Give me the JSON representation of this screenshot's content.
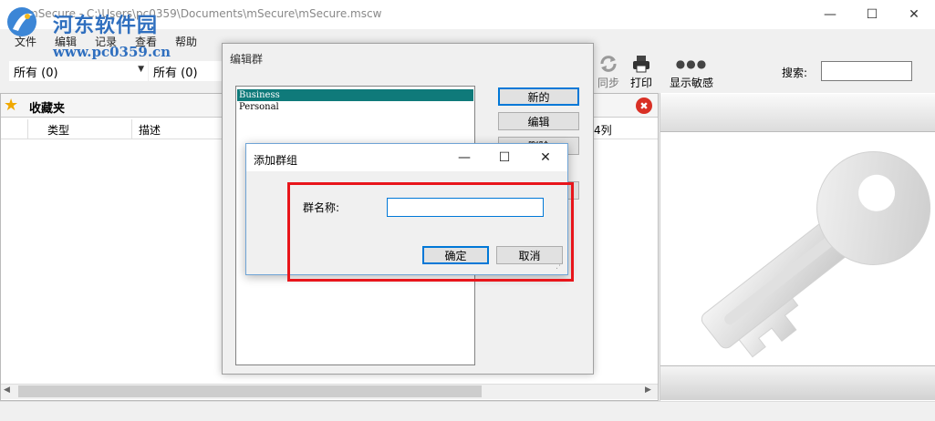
{
  "window": {
    "title": "mSecure - C:\\Users\\pc0359\\Documents\\mSecure\\mSecure.mscw",
    "minimize_glyph": "—",
    "maximize_glyph": "☐",
    "close_glyph": "✕"
  },
  "watermark": {
    "name": "河东软件园",
    "url": "www.pc0359.cn"
  },
  "menu": [
    "文件",
    "编辑",
    "记录",
    "查看",
    "帮助"
  ],
  "toolbar": {
    "combo1": "所有 (0)",
    "combo2": "所有 (0)",
    "sync_label": "同步",
    "print_label": "打印",
    "sensitive_label": "显示敏感",
    "sensitive_glyph": "●●●",
    "search_label": "搜索:",
    "search_value": ""
  },
  "favorites": {
    "title": "收藏夹",
    "close_glyph": "✖",
    "columns": [
      "类型",
      "描述",
      "4列"
    ]
  },
  "edit_group_dialog": {
    "title": "编辑群",
    "groups": [
      "Business",
      "Personal"
    ],
    "selected": "Business",
    "buttons": {
      "new": "新的",
      "edit": "编辑",
      "delete": "删除"
    }
  },
  "add_group_dialog": {
    "title": "添加群组",
    "field_label": "群名称:",
    "field_value": "",
    "ok": "确定",
    "cancel": "取消"
  },
  "colors": {
    "highlight": "#e8151b",
    "selection": "#0f7a7a",
    "accent": "#0078d7"
  }
}
